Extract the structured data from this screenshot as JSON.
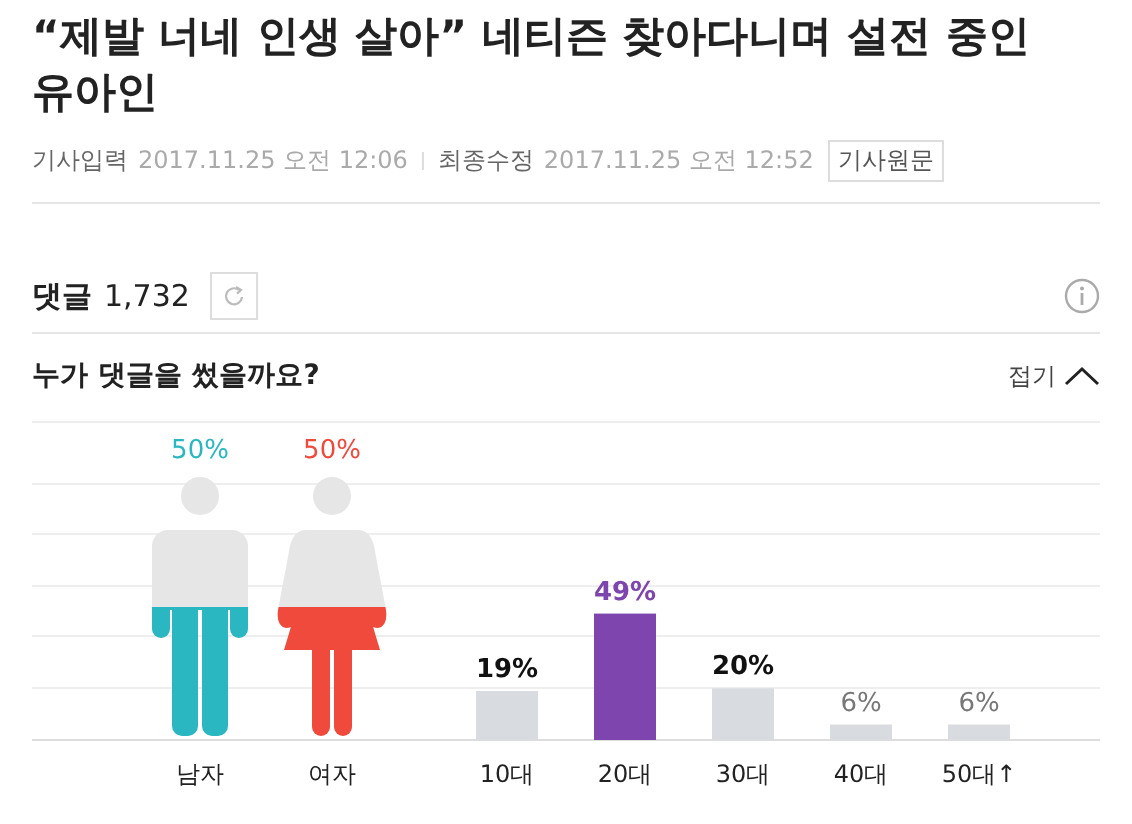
{
  "article": {
    "title": "“제발 너네 인생 살아” 네티즌 찾아다니며 설전 중인 유아인",
    "meta": [
      {
        "label": "기사입력",
        "value": "2017.11.25 오전 12:06"
      },
      {
        "label": "최종수정",
        "value": "2017.11.25 오전 12:52"
      }
    ],
    "original_button": "기사원문"
  },
  "comments": {
    "label": "댓글",
    "count": "1,732"
  },
  "stats": {
    "title": "누가 댓글을 썼을까요?",
    "collapse": "접기",
    "gender": [
      {
        "kind": "male",
        "label": "남자",
        "percent": "50%",
        "color": "#2ab7c2"
      },
      {
        "kind": "female",
        "label": "여자",
        "percent": "50%",
        "color": "#ef4a3b"
      }
    ],
    "chart_data": {
      "type": "bar",
      "categories": [
        "10대",
        "20대",
        "30대",
        "40대",
        "50대↑"
      ],
      "values": [
        19,
        49,
        20,
        6,
        6
      ],
      "value_labels": [
        "19%",
        "49%",
        "20%",
        "6%",
        "6%"
      ]
    }
  }
}
